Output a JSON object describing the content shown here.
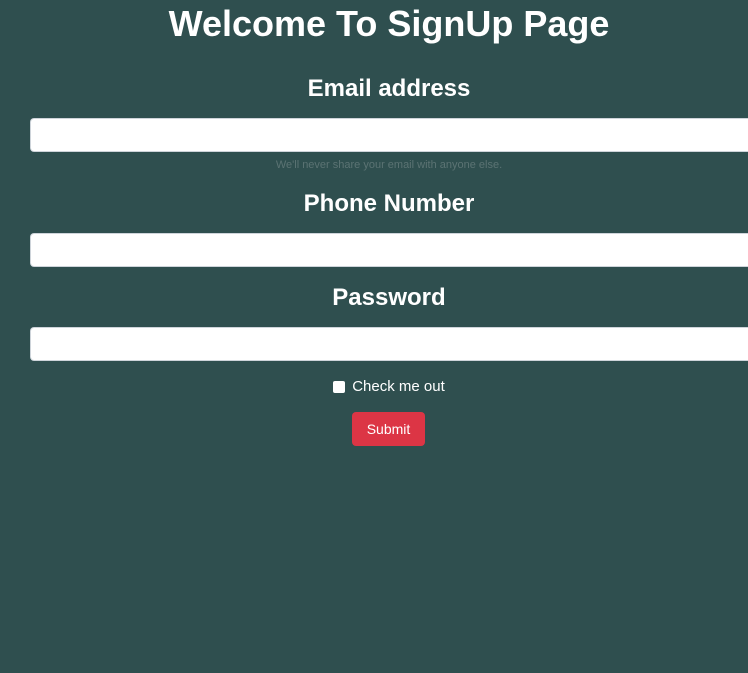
{
  "page": {
    "title": "Welcome To SignUp Page"
  },
  "form": {
    "email": {
      "label": "Email address",
      "value": "",
      "placeholder": "",
      "help_text": "We'll never share your email with anyone else."
    },
    "phone": {
      "label": "Phone Number",
      "value": "",
      "placeholder": ""
    },
    "password": {
      "label": "Password",
      "value": "",
      "placeholder": ""
    },
    "checkbox": {
      "label": "Check me out",
      "checked": false
    },
    "submit_label": "Submit"
  },
  "colors": {
    "background": "#2f4f4f",
    "text": "#ffffff",
    "submit": "#dc3545",
    "help_text": "#5b7373"
  }
}
